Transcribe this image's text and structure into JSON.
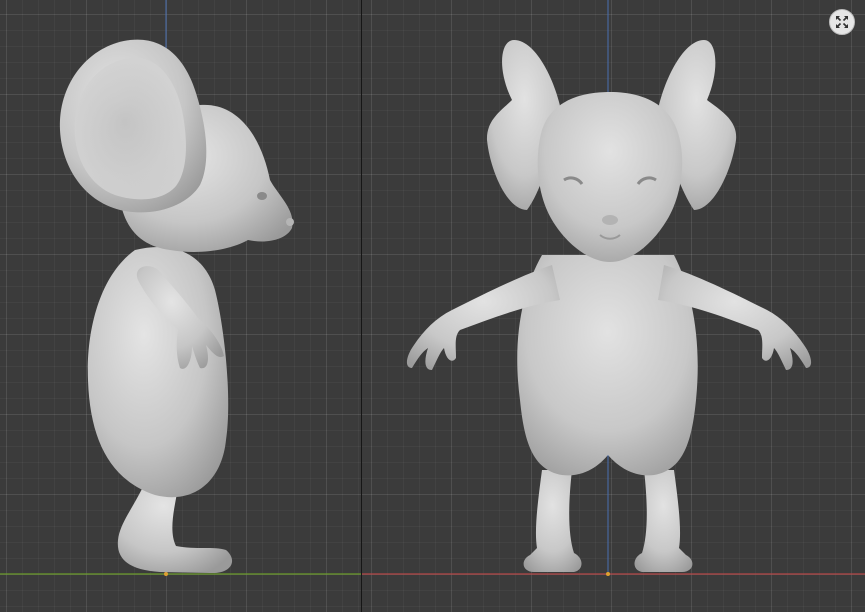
{
  "window": {},
  "viewports": [
    {
      "id": "left",
      "view": "side"
    },
    {
      "id": "right",
      "view": "front"
    }
  ],
  "controls": {
    "maximize_icon": "expand-arrows-icon"
  },
  "colors": {
    "background": "#3b3b3b",
    "grid": "#4a4a4a",
    "axis_x": "#b34747",
    "axis_y": "#6a9a2a",
    "axis_z": "#4a6fb0",
    "model": "#cfcfcf"
  }
}
